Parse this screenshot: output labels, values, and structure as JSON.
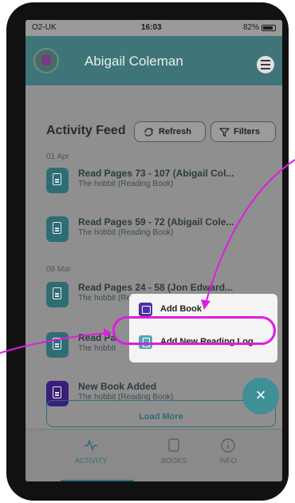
{
  "status_bar": {
    "carrier": "O2-UK",
    "time": "16:03",
    "battery": "82%"
  },
  "header": {
    "user_name": "Abigail Coleman"
  },
  "feed": {
    "title": "Activity Feed",
    "refresh_label": "Refresh",
    "filters_label": "Filters",
    "groups": [
      {
        "date": "01 Apr",
        "items": [
          {
            "title": "Read Pages 73 - 107 (Abigail Col...",
            "subtitle": "The hobbit  (Reading Book)"
          },
          {
            "title": "Read Pages 59 - 72 (Abigail Cole...",
            "subtitle": "The hobbit  (Reading Book)"
          }
        ]
      },
      {
        "date": "08 Mar",
        "items": [
          {
            "title": "Read Pages 24 - 58 (Jon Edward...",
            "subtitle": "The hobbit  (Reading Book)"
          },
          {
            "title": "Read Pa",
            "subtitle": "The hobbit"
          },
          {
            "title": "New Book Added",
            "subtitle": "The hobbit  (Reading Book)"
          }
        ]
      }
    ],
    "load_more_label": "Load More"
  },
  "popup_menu": {
    "add_book_label": "Add Book",
    "add_reading_log_label": "Add New Reading Log"
  },
  "fab": {
    "label": "×"
  },
  "bottom_nav": {
    "tabs": [
      {
        "label": "ACTIVITY"
      },
      {
        "label": "BOOKS"
      },
      {
        "label": "INFO"
      }
    ]
  },
  "colors": {
    "primary": "#2f6d74",
    "header": "#3f7578",
    "fab": "#3f8f97",
    "annotation": "#e11be0",
    "new_book_icon": "#3a1f7a"
  }
}
